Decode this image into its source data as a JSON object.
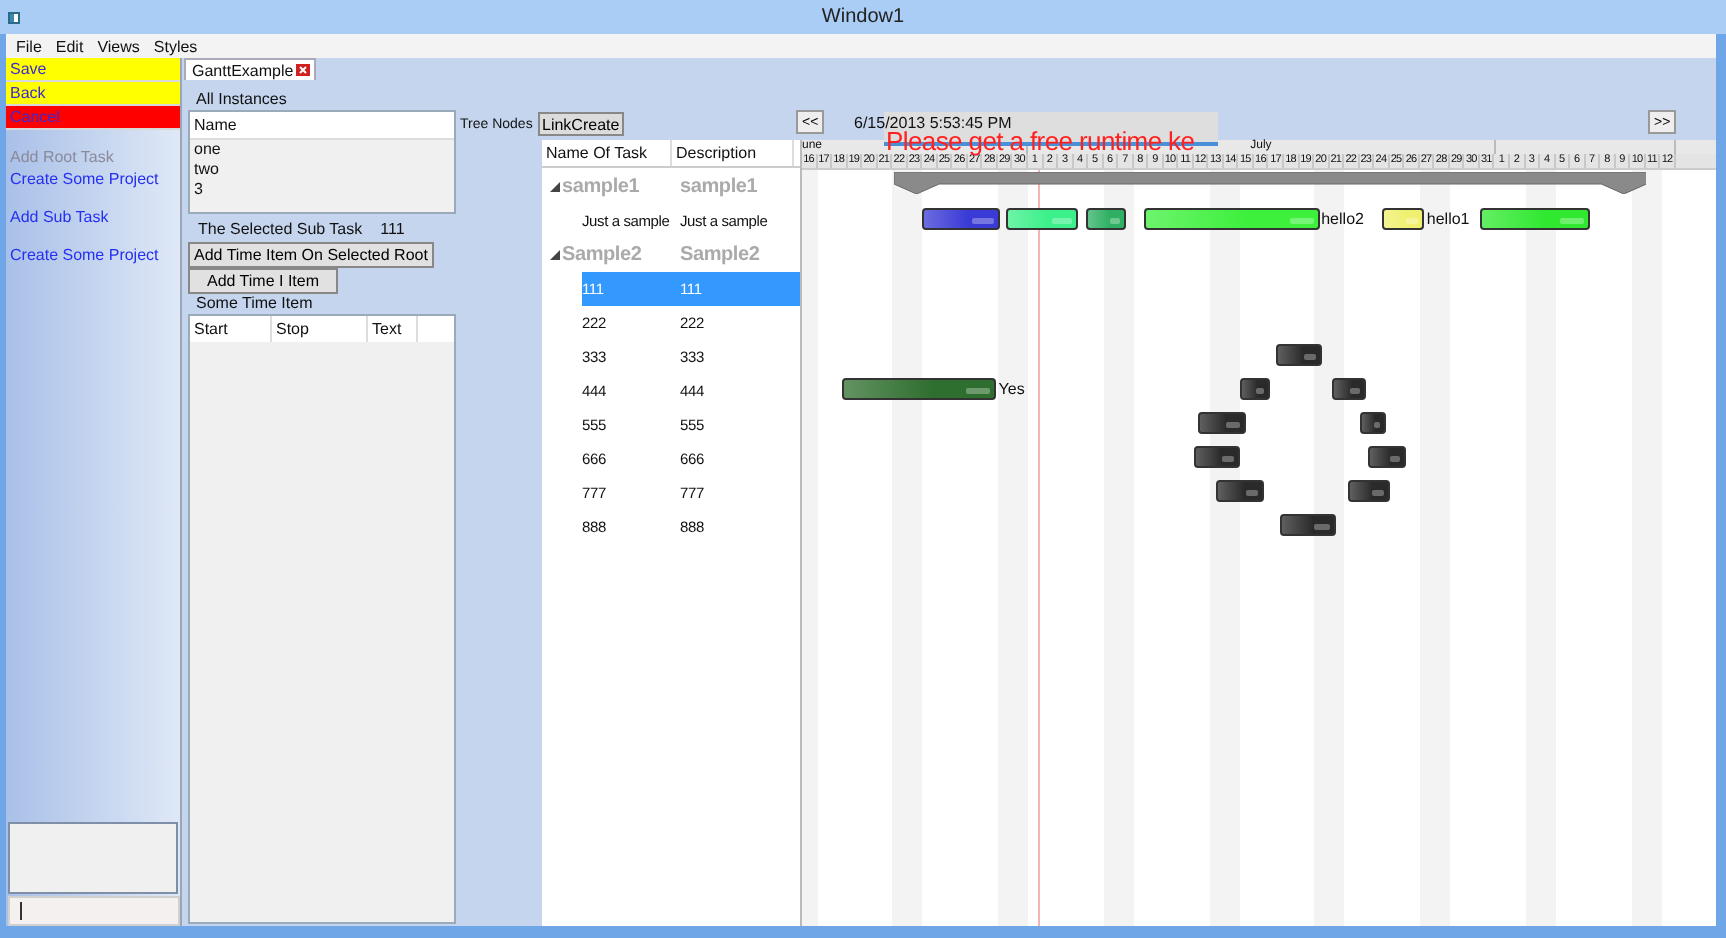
{
  "window": {
    "title": "Window1"
  },
  "menu": [
    "File",
    "Edit",
    "Views",
    "Styles"
  ],
  "sidebar": {
    "buttons": [
      {
        "label": "Save",
        "color": "#ffff00"
      },
      {
        "label": "Back",
        "color": "#ffff00"
      },
      {
        "label": "Cancel",
        "color": "#ff0000"
      }
    ],
    "link_groups": [
      [
        {
          "label": "Add Root Task",
          "disabled": true
        },
        {
          "label": "Create Some Project",
          "disabled": false
        }
      ],
      [
        {
          "label": "Add Sub Task",
          "disabled": false
        }
      ],
      [
        {
          "label": "Create Some Project",
          "disabled": false
        }
      ]
    ]
  },
  "tabs": [
    {
      "label": "GanttExample",
      "selected": true
    }
  ],
  "instances": {
    "title": "All Instances",
    "column": "Name",
    "rows": [
      "one",
      "two",
      "3"
    ]
  },
  "selected_sub_task": {
    "label": "The Selected Sub Task",
    "value": "111"
  },
  "actions": [
    "Add Time Item On Selected Root",
    "Add Time I Item"
  ],
  "time_items": {
    "title": "Some Time Item",
    "columns": [
      "Start",
      "Stop",
      "Text"
    ]
  },
  "tree": {
    "label": "Tree Nodes",
    "link_button": "LinkCreate",
    "columns": [
      "Name Of Task",
      "Description"
    ],
    "nodes": [
      {
        "name": "sample1",
        "description": "sample1",
        "expanded": true,
        "selected": false,
        "summary": true,
        "children": [
          {
            "name": "Just a sample",
            "description": "Just a sample",
            "selected": false,
            "bars": [
              {
                "color": "#3a3ad6"
              },
              {
                "color": "#3cf08a"
              },
              {
                "color": "#2fb064"
              },
              {
                "color": "#3cf03c",
                "label": "hello2"
              },
              {
                "color": "#f0f070",
                "label": "hello1"
              },
              {
                "color": "#30e830"
              }
            ]
          }
        ]
      },
      {
        "name": "Sample2",
        "description": "Sample2",
        "expanded": true,
        "selected": false,
        "children": [
          {
            "name": "111",
            "description": "111",
            "selected": true
          },
          {
            "name": "222",
            "description": "222",
            "selected": false
          },
          {
            "name": "333",
            "description": "333",
            "selected": false,
            "bars": [
              {
                "color": "#2a2a2a"
              }
            ]
          },
          {
            "name": "444",
            "description": "444",
            "selected": false,
            "bars": [
              {
                "color": "#2e6e2e",
                "label": "Yes"
              },
              {
                "color": "#2a2a2a"
              },
              {
                "color": "#2a2a2a"
              }
            ]
          },
          {
            "name": "555",
            "description": "555",
            "selected": false,
            "bars": [
              {
                "color": "#2a2a2a"
              },
              {
                "color": "#2a2a2a"
              }
            ]
          },
          {
            "name": "666",
            "description": "666",
            "selected": false,
            "bars": [
              {
                "color": "#2a2a2a"
              },
              {
                "color": "#2a2a2a"
              }
            ]
          },
          {
            "name": "777",
            "description": "777",
            "selected": false,
            "bars": [
              {
                "color": "#2a2a2a"
              },
              {
                "color": "#2a2a2a"
              }
            ]
          },
          {
            "name": "888",
            "description": "888",
            "selected": false,
            "bars": [
              {
                "color": "#2a2a2a"
              }
            ]
          }
        ]
      }
    ]
  },
  "gantt": {
    "prev": "<<",
    "next": ">>",
    "date": "6/15/2013 5:53:45 PM",
    "notice": "Please get a free runtime ke",
    "months": [
      {
        "label": "une",
        "days": [
          "16",
          "17",
          "18",
          "19",
          "20",
          "21",
          "22",
          "23",
          "24",
          "25",
          "26",
          "27",
          "28",
          "29",
          "30"
        ]
      },
      {
        "label": "July",
        "days": [
          "1",
          "2",
          "3",
          "4",
          "5",
          "6",
          "7",
          "8",
          "9",
          "10",
          "11",
          "12",
          "13",
          "14",
          "15",
          "16",
          "17",
          "18",
          "19",
          "20",
          "21",
          "22",
          "23",
          "24",
          "25",
          "26",
          "27",
          "28",
          "29",
          "30",
          "31"
        ]
      },
      {
        "days": [
          "1",
          "2",
          "3",
          "4",
          "5",
          "6",
          "7",
          "8",
          "9",
          "10",
          "11",
          "12"
        ]
      }
    ]
  }
}
